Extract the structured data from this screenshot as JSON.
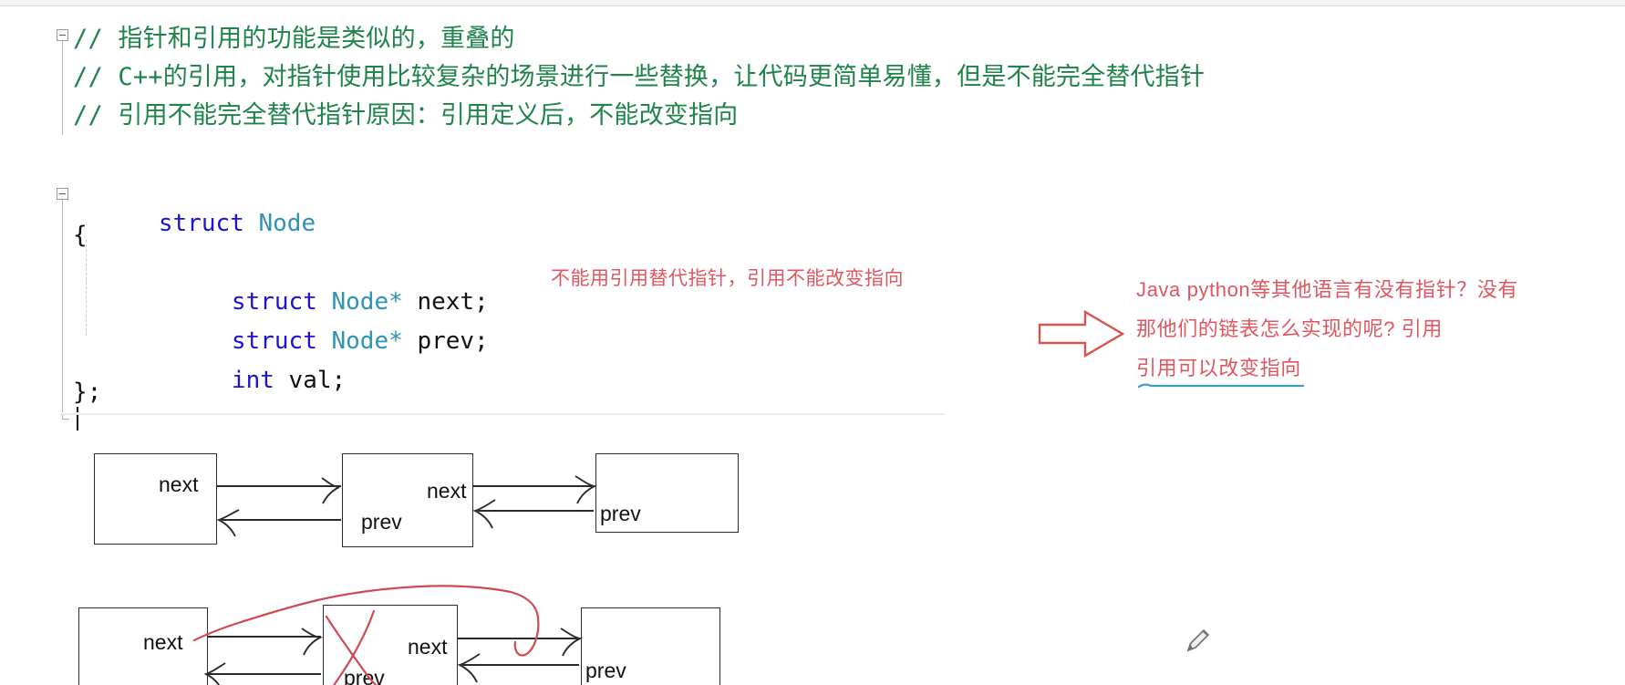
{
  "window": {
    "app": "code-editor",
    "background": "#ffffff"
  },
  "colors": {
    "comment_green": "#1e8449",
    "keyword_blue": "#1a12d6",
    "type_teal": "#2f93b5",
    "ink_red": "#e0565f",
    "ink_blue": "#3d9bbd",
    "box_outline": "#2b2b2b"
  },
  "code": {
    "comments": [
      "// 指针和引用的功能是类似的，重叠的",
      "// C++的引用，对指针使用比较复杂的场景进行一些替换，让代码更简单易懂，但是不能完全替代指针",
      "// 引用不能完全替代指针原因：引用定义后，不能改变指向"
    ],
    "struct": {
      "line1_kw": "struct",
      "line1_type": "Node",
      "line2": "{",
      "member1": {
        "kw": "struct",
        "type": "Node*",
        "name": "next;"
      },
      "member2": {
        "kw": "struct",
        "type": "Node*",
        "name": "prev;"
      },
      "member3": {
        "kw": "int",
        "name": "val;"
      },
      "line_end": "};"
    }
  },
  "annotations": {
    "inline_note": "不能用引用替代指针，引用不能改变指向",
    "right_note": [
      "Java python等其他语言有没有指针？没有",
      "那他们的链表怎么实现的呢? 引用",
      "引用可以改变指向"
    ],
    "arrow_icon": "right-arrow-icon",
    "underline_icon": "blue-underline-stroke"
  },
  "diagram": {
    "row1": {
      "boxes": [
        {
          "labels": [
            "next"
          ]
        },
        {
          "labels": [
            "next",
            "prev"
          ]
        },
        {
          "labels": [
            "prev"
          ]
        }
      ]
    },
    "row2": {
      "boxes": [
        {
          "labels": [
            "next"
          ]
        },
        {
          "labels": [
            "next",
            "prev"
          ]
        },
        {
          "labels": [
            "prev"
          ]
        }
      ]
    },
    "labels": {
      "next": "next",
      "prev": "prev"
    }
  },
  "cursor": {
    "icon": "pencil-cursor-icon"
  }
}
